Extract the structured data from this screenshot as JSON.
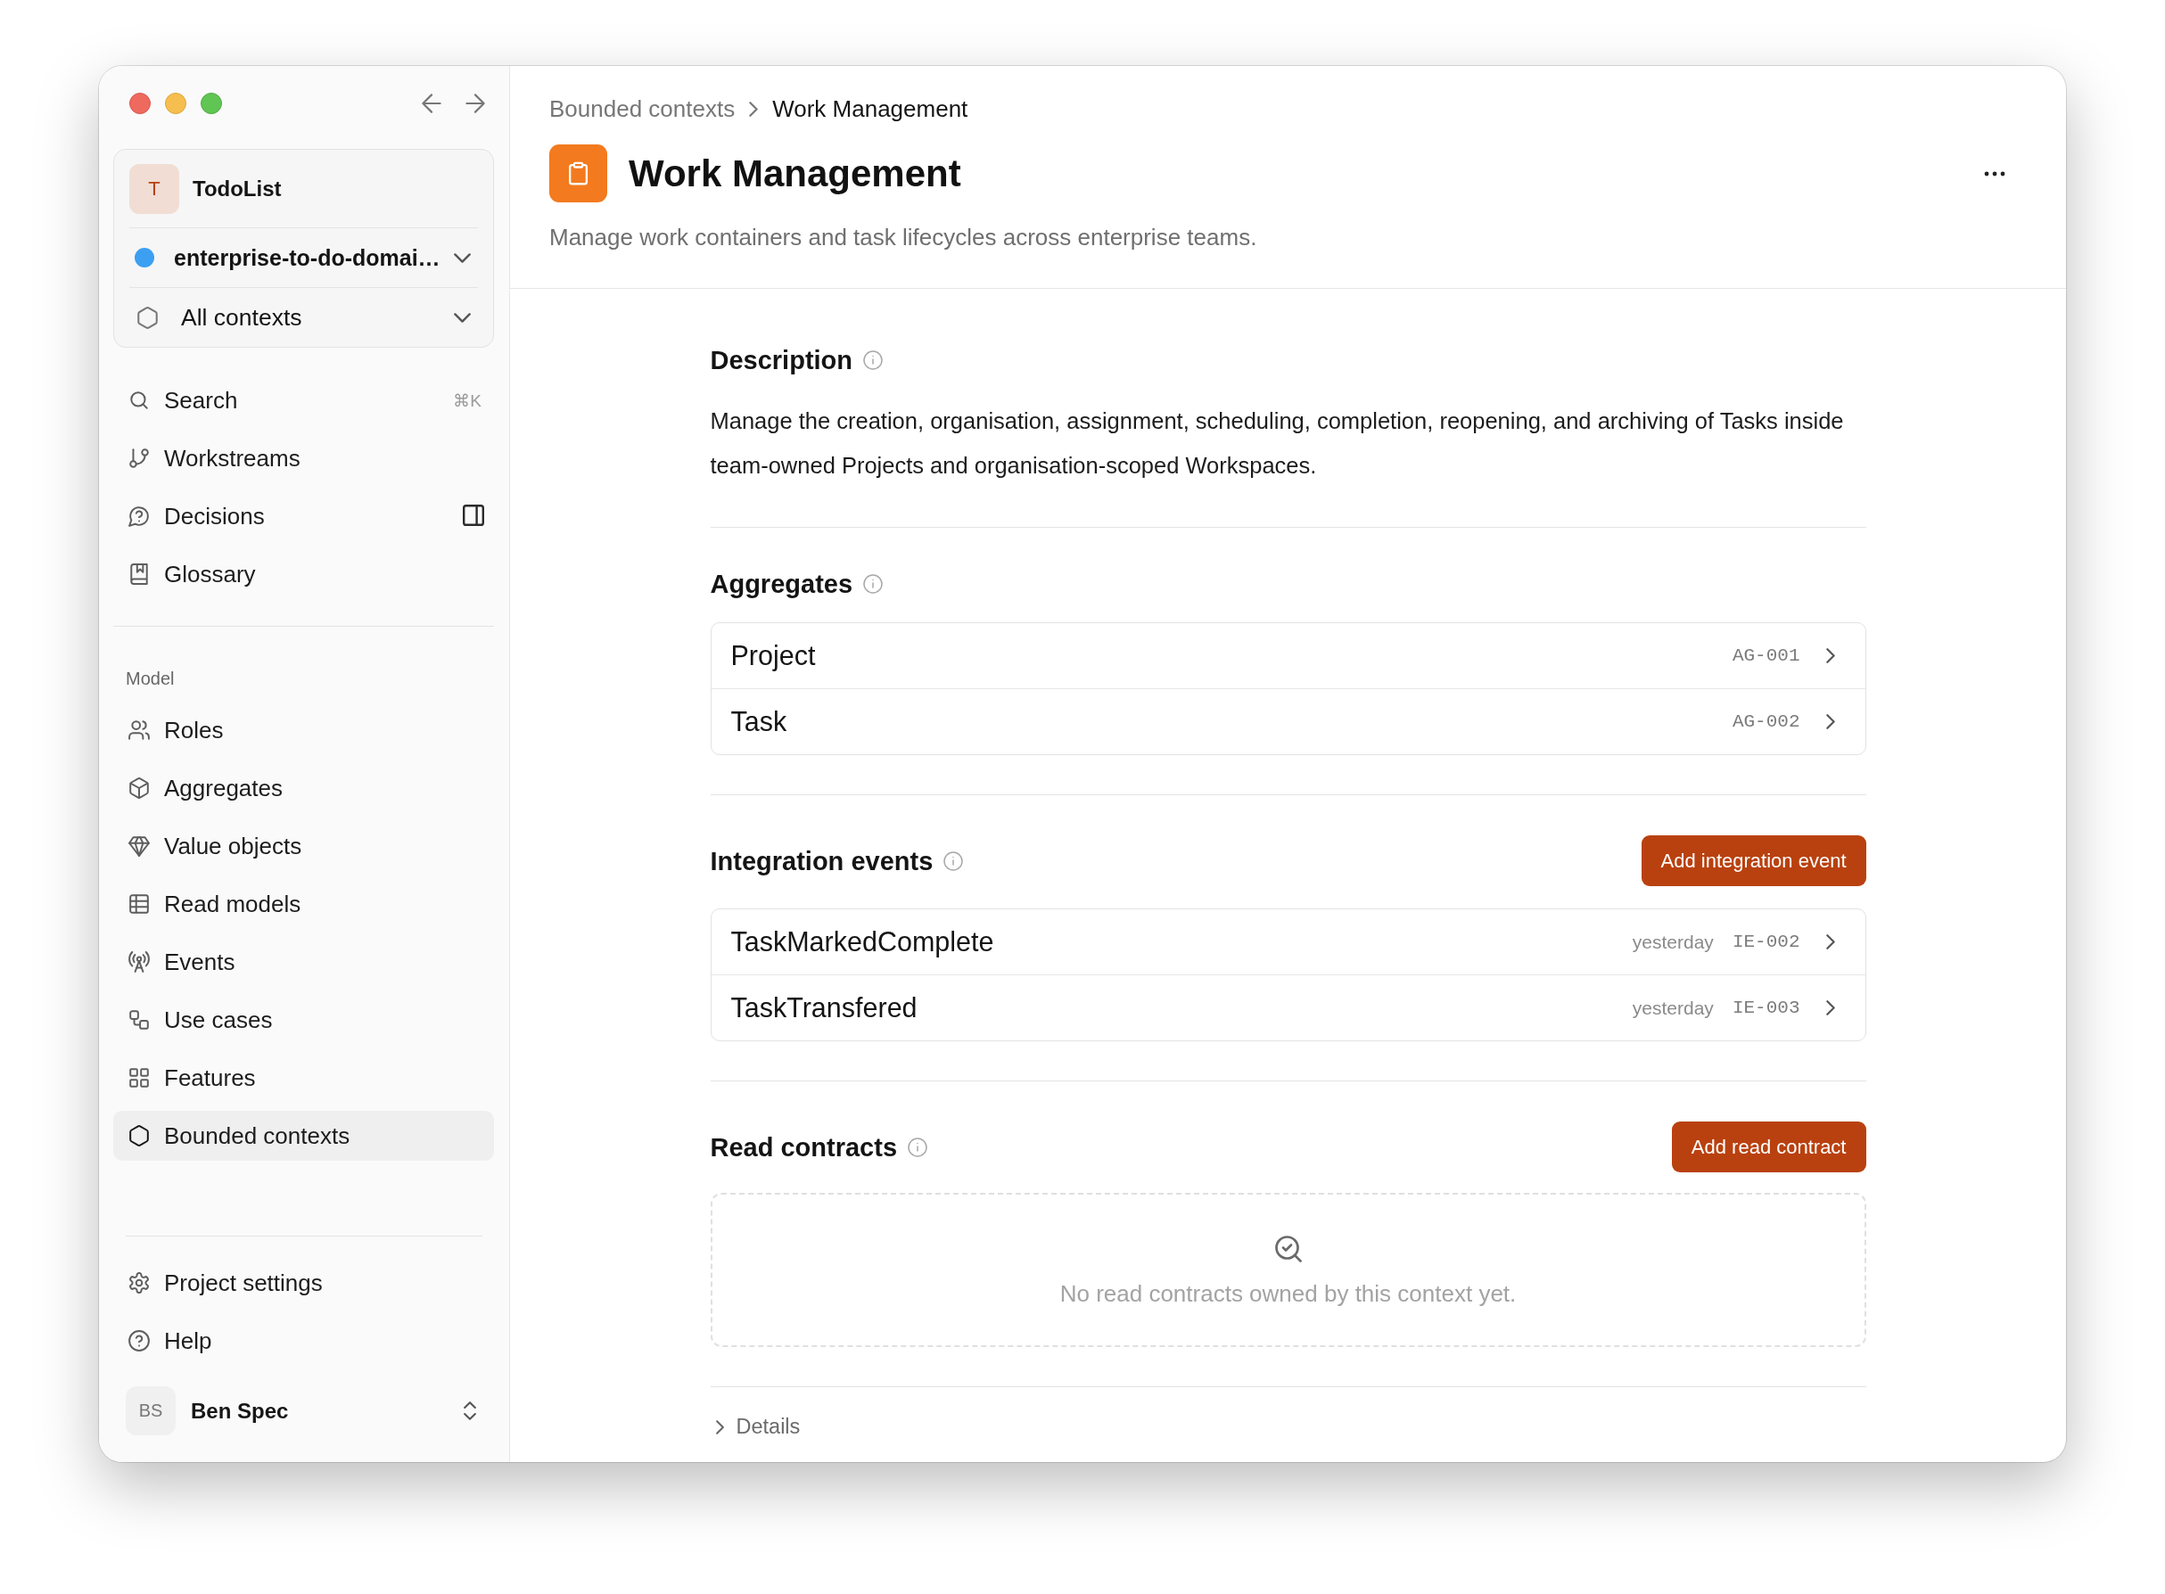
{
  "sidebar": {
    "project": {
      "avatar": "T",
      "name": "TodoList"
    },
    "workspace": {
      "name": "enterprise-to-do-domai…"
    },
    "context_filter": {
      "label": "All contexts"
    },
    "nav": [
      {
        "label": "Search",
        "shortcut": "⌘K",
        "selected": false
      },
      {
        "label": "Workstreams",
        "selected": false
      },
      {
        "label": "Decisions",
        "selected": false
      },
      {
        "label": "Glossary",
        "selected": false
      }
    ],
    "model": {
      "title": "Model",
      "items": [
        {
          "label": "Roles",
          "selected": false
        },
        {
          "label": "Aggregates",
          "selected": false
        },
        {
          "label": "Value objects",
          "selected": false
        },
        {
          "label": "Read models",
          "selected": false
        },
        {
          "label": "Events",
          "selected": false
        },
        {
          "label": "Use cases",
          "selected": false
        },
        {
          "label": "Features",
          "selected": false
        },
        {
          "label": "Bounded contexts",
          "selected": true
        }
      ]
    },
    "footer": [
      {
        "label": "Project settings",
        "selected": false
      },
      {
        "label": "Help",
        "selected": false
      }
    ],
    "user": {
      "initials": "BS",
      "name": "Ben Spec"
    }
  },
  "main": {
    "breadcrumb": [
      {
        "label": "Bounded contexts",
        "current": false
      },
      {
        "label": "Work Management",
        "current": true
      }
    ],
    "title": "Work Management",
    "subtitle": "Manage work containers and task lifecycles across enterprise teams.",
    "sections": [
      {
        "kind": "text",
        "title": "Description",
        "body": "Manage the creation, organisation, assignment, scheduling, completion, reopening, and archiving of Tasks inside team-owned Projects and organisation-scoped Workspaces."
      },
      {
        "kind": "list",
        "title": "Aggregates",
        "items": [
          {
            "name": "Project",
            "code": "AG-001"
          },
          {
            "name": "Task",
            "code": "AG-002"
          }
        ]
      },
      {
        "kind": "list",
        "title": "Integration events",
        "action": "Add integration event",
        "items": [
          {
            "name": "TaskMarkedComplete",
            "time": "yesterday",
            "code": "IE-002"
          },
          {
            "name": "TaskTransfered",
            "time": "yesterday",
            "code": "IE-003"
          }
        ]
      },
      {
        "kind": "empty",
        "title": "Read contracts",
        "action": "Add read contract",
        "empty_text": "No read contracts owned by this context yet."
      }
    ],
    "details": {
      "label": "Details",
      "expanded": false
    }
  }
}
